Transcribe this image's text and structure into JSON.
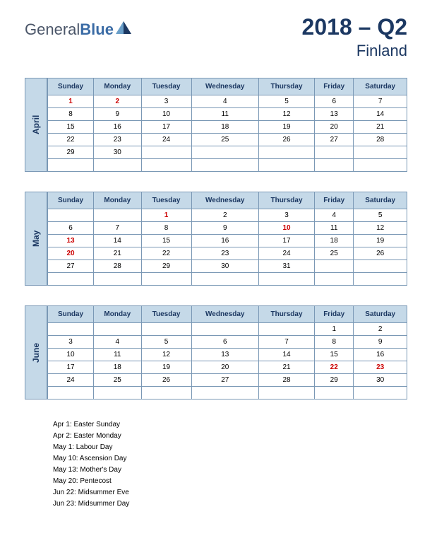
{
  "logo": {
    "general": "General",
    "blue": "Blue"
  },
  "title": "2018 – Q2",
  "country": "Finland",
  "weekdays": [
    "Sunday",
    "Monday",
    "Tuesday",
    "Wednesday",
    "Thursday",
    "Friday",
    "Saturday"
  ],
  "months": [
    {
      "name": "April",
      "weeks": [
        [
          {
            "d": "1",
            "h": true
          },
          {
            "d": "2",
            "h": true
          },
          {
            "d": "3"
          },
          {
            "d": "4"
          },
          {
            "d": "5"
          },
          {
            "d": "6"
          },
          {
            "d": "7"
          }
        ],
        [
          {
            "d": "8"
          },
          {
            "d": "9"
          },
          {
            "d": "10"
          },
          {
            "d": "11"
          },
          {
            "d": "12"
          },
          {
            "d": "13"
          },
          {
            "d": "14"
          }
        ],
        [
          {
            "d": "15"
          },
          {
            "d": "16"
          },
          {
            "d": "17"
          },
          {
            "d": "18"
          },
          {
            "d": "19"
          },
          {
            "d": "20"
          },
          {
            "d": "21"
          }
        ],
        [
          {
            "d": "22"
          },
          {
            "d": "23"
          },
          {
            "d": "24"
          },
          {
            "d": "25"
          },
          {
            "d": "26"
          },
          {
            "d": "27"
          },
          {
            "d": "28"
          }
        ],
        [
          {
            "d": "29"
          },
          {
            "d": "30"
          },
          {
            "d": ""
          },
          {
            "d": ""
          },
          {
            "d": ""
          },
          {
            "d": ""
          },
          {
            "d": ""
          }
        ],
        [
          {
            "d": ""
          },
          {
            "d": ""
          },
          {
            "d": ""
          },
          {
            "d": ""
          },
          {
            "d": ""
          },
          {
            "d": ""
          },
          {
            "d": ""
          }
        ]
      ]
    },
    {
      "name": "May",
      "weeks": [
        [
          {
            "d": ""
          },
          {
            "d": ""
          },
          {
            "d": "1",
            "h": true
          },
          {
            "d": "2"
          },
          {
            "d": "3"
          },
          {
            "d": "4"
          },
          {
            "d": "5"
          }
        ],
        [
          {
            "d": "6"
          },
          {
            "d": "7"
          },
          {
            "d": "8"
          },
          {
            "d": "9"
          },
          {
            "d": "10",
            "h": true
          },
          {
            "d": "11"
          },
          {
            "d": "12"
          }
        ],
        [
          {
            "d": "13",
            "h": true
          },
          {
            "d": "14"
          },
          {
            "d": "15"
          },
          {
            "d": "16"
          },
          {
            "d": "17"
          },
          {
            "d": "18"
          },
          {
            "d": "19"
          }
        ],
        [
          {
            "d": "20",
            "h": true
          },
          {
            "d": "21"
          },
          {
            "d": "22"
          },
          {
            "d": "23"
          },
          {
            "d": "24"
          },
          {
            "d": "25"
          },
          {
            "d": "26"
          }
        ],
        [
          {
            "d": "27"
          },
          {
            "d": "28"
          },
          {
            "d": "29"
          },
          {
            "d": "30"
          },
          {
            "d": "31"
          },
          {
            "d": ""
          },
          {
            "d": ""
          }
        ],
        [
          {
            "d": ""
          },
          {
            "d": ""
          },
          {
            "d": ""
          },
          {
            "d": ""
          },
          {
            "d": ""
          },
          {
            "d": ""
          },
          {
            "d": ""
          }
        ]
      ]
    },
    {
      "name": "June",
      "weeks": [
        [
          {
            "d": ""
          },
          {
            "d": ""
          },
          {
            "d": ""
          },
          {
            "d": ""
          },
          {
            "d": ""
          },
          {
            "d": "1"
          },
          {
            "d": "2"
          }
        ],
        [
          {
            "d": "3"
          },
          {
            "d": "4"
          },
          {
            "d": "5"
          },
          {
            "d": "6"
          },
          {
            "d": "7"
          },
          {
            "d": "8"
          },
          {
            "d": "9"
          }
        ],
        [
          {
            "d": "10"
          },
          {
            "d": "11"
          },
          {
            "d": "12"
          },
          {
            "d": "13"
          },
          {
            "d": "14"
          },
          {
            "d": "15"
          },
          {
            "d": "16"
          }
        ],
        [
          {
            "d": "17"
          },
          {
            "d": "18"
          },
          {
            "d": "19"
          },
          {
            "d": "20"
          },
          {
            "d": "21"
          },
          {
            "d": "22",
            "h": true
          },
          {
            "d": "23",
            "h": true
          }
        ],
        [
          {
            "d": "24"
          },
          {
            "d": "25"
          },
          {
            "d": "26"
          },
          {
            "d": "27"
          },
          {
            "d": "28"
          },
          {
            "d": "29"
          },
          {
            "d": "30"
          }
        ],
        [
          {
            "d": ""
          },
          {
            "d": ""
          },
          {
            "d": ""
          },
          {
            "d": ""
          },
          {
            "d": ""
          },
          {
            "d": ""
          },
          {
            "d": ""
          }
        ]
      ]
    }
  ],
  "holidays": [
    "Apr 1: Easter Sunday",
    "Apr 2: Easter Monday",
    "May 1: Labour Day",
    "May 10: Ascension Day",
    "May 13: Mother's Day",
    "May 20: Pentecost",
    "Jun 22: Midsummer Eve",
    "Jun 23: Midsummer Day"
  ]
}
